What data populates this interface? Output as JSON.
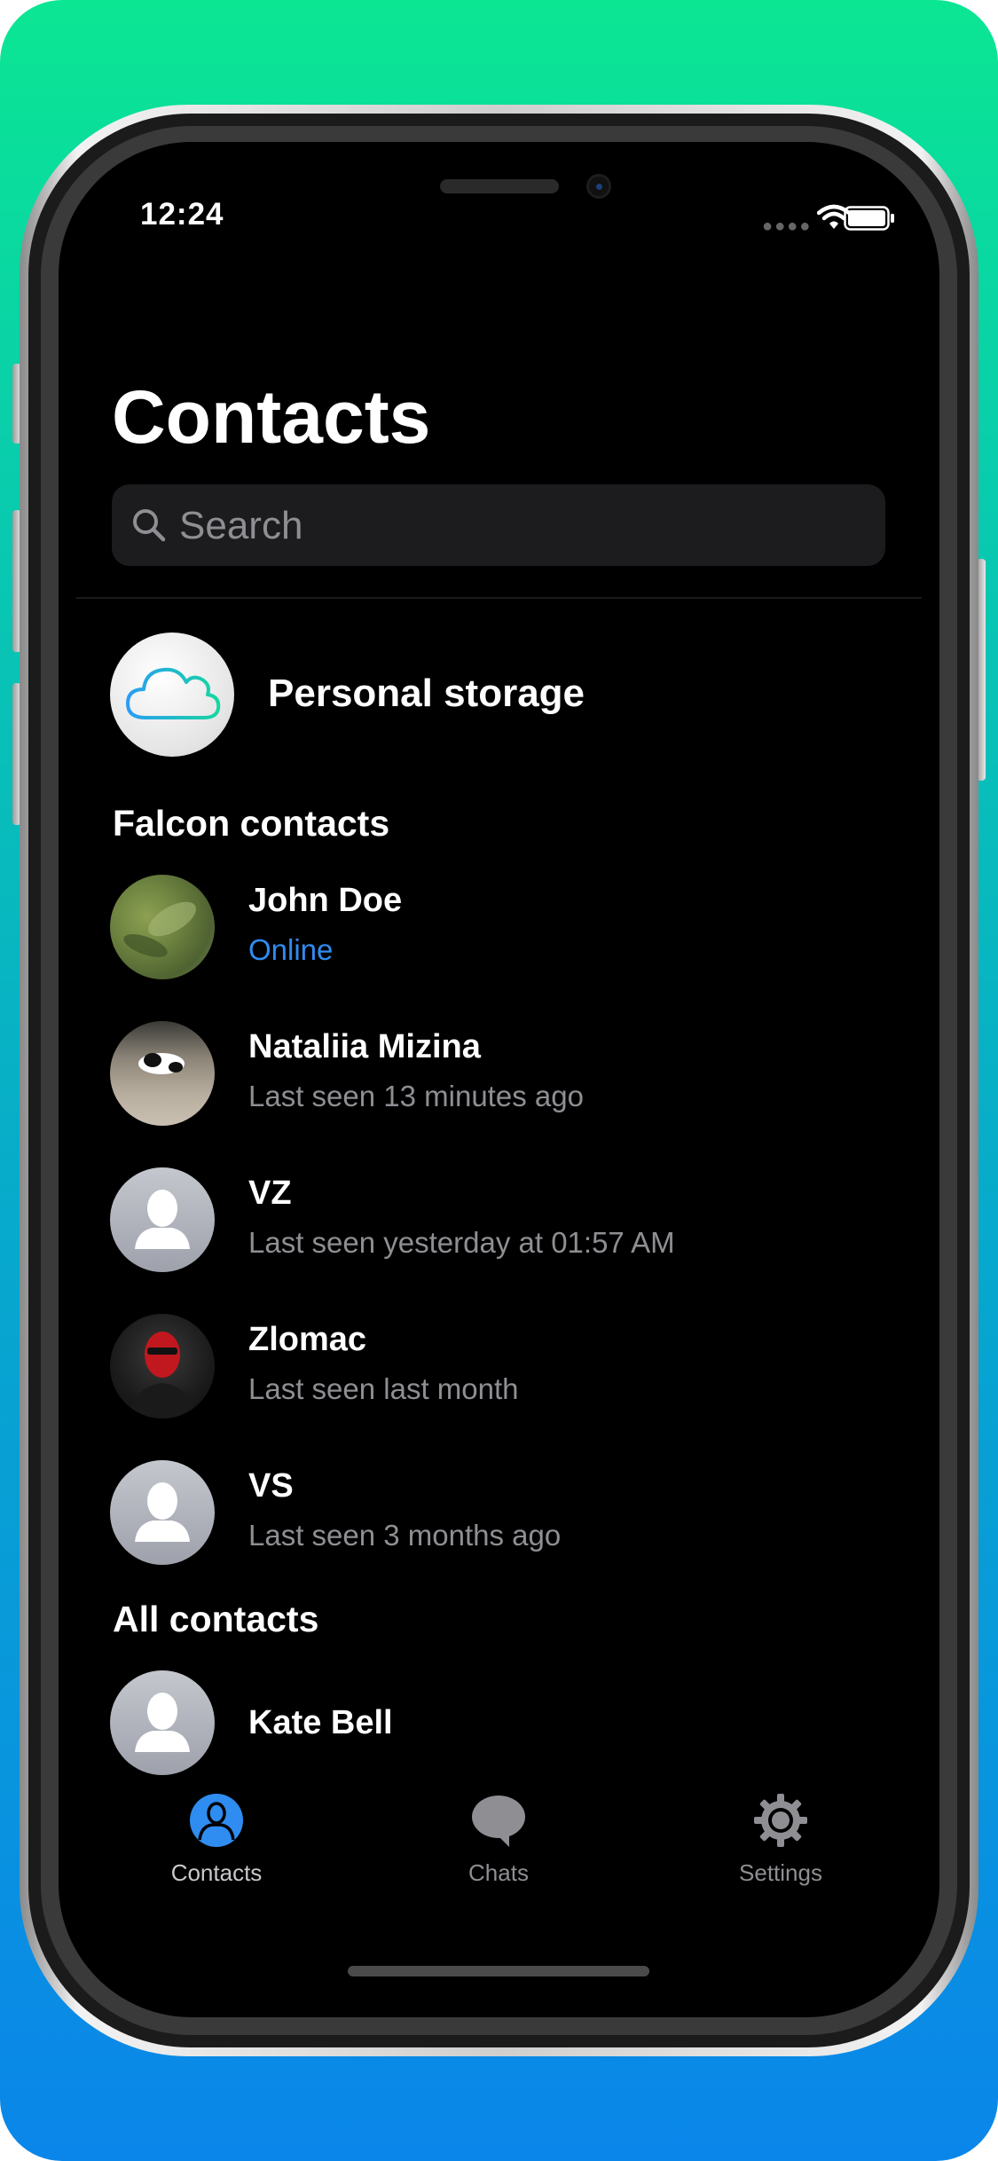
{
  "status_bar": {
    "time": "12:24"
  },
  "header": {
    "title": "Contacts"
  },
  "search": {
    "placeholder": "Search"
  },
  "personal_storage": {
    "label": "Personal storage"
  },
  "sections": {
    "falcon": "Falcon contacts",
    "all": "All contacts"
  },
  "falcon_contacts": [
    {
      "name": "John Doe",
      "status": "Online",
      "avatar": "photo-leaf"
    },
    {
      "name": "Nataliia Mizina",
      "status": "Last seen 13 minutes ago",
      "avatar": "photo-cat"
    },
    {
      "name": "VZ",
      "status": "Last seen yesterday at 01:57 AM",
      "avatar": "default-person-icon"
    },
    {
      "name": "Zlomac",
      "status": "Last seen last month",
      "avatar": "photo-masked"
    },
    {
      "name": "VS",
      "status": "Last seen 3 months ago",
      "avatar": "default-person-icon"
    }
  ],
  "all_contacts": [
    {
      "name": "Kate Bell",
      "avatar": "default-person-icon"
    }
  ],
  "tabbar": {
    "items": [
      {
        "label": "Contacts",
        "icon": "contacts-icon",
        "active": true
      },
      {
        "label": "Chats",
        "icon": "chat-bubble-icon",
        "active": false
      },
      {
        "label": "Settings",
        "icon": "gear-icon",
        "active": false
      }
    ]
  },
  "colors": {
    "accent": "#2f8cf0",
    "background": "#000000",
    "secondary_text": "#8e8e93",
    "frame_gradient_top": "#0be693",
    "frame_gradient_bottom": "#0a86ea"
  }
}
